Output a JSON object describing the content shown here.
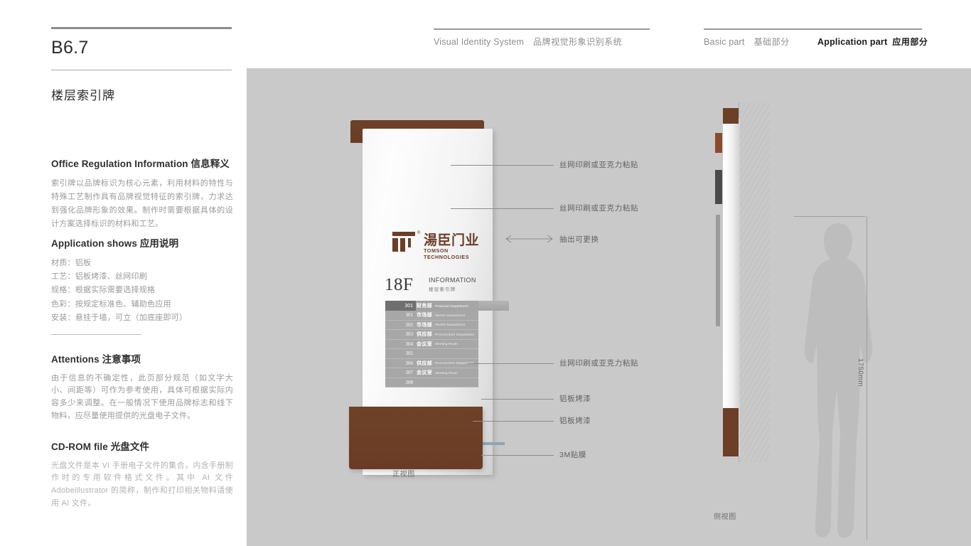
{
  "header": {
    "vis_en": "Visual Identity System",
    "vis_cn": "品牌视觉形象识别系统",
    "basic_en": "Basic part",
    "basic_cn": "基础部分",
    "app_en": "Application part",
    "app_cn": "应用部分"
  },
  "page": {
    "code": "B6.7",
    "section_title": "楼层索引牌"
  },
  "blocks": {
    "office": {
      "heading": "Office Regulation Information 信息释义",
      "body": "索引牌以品牌标识为核心元素，利用材料的特性与特殊工艺制作具有品牌视觉特征的索引牌，力求达到强化品牌形象的效果。制作时需要根据具体的设计方案选择标识的材料和工艺。"
    },
    "application": {
      "heading": "Application shows 应用说明",
      "lines": [
        "材质：铝板",
        "工艺：铝板烤漆、丝网印刷",
        "规格：根据实际需要选择规格",
        "色彩：按规定标准色、辅助色应用",
        "安装：悬挂于墙，可立（加底座即可）"
      ]
    },
    "attentions": {
      "heading": "Attentions 注意事项",
      "body": "由于信息的不确定性，此页部分规范（如文字大小、间距等）可作为参考使用，具体可根据实际内容多少来调整。在一般情况下使用品牌标志和线下物料，应尽量使用提供的光盘电子文件。"
    },
    "cdrom": {
      "heading": "CD-ROM file 光盘文件",
      "body": "光盘文件是本 VI 手册电子文件的集合，内含手册制作时的专用软件格式文件。其中 AI 文件 Adobeillustrator 的简称，制作和打印相关物料请使用 AI 文件。"
    }
  },
  "sign": {
    "logo_cn": "湯臣门业",
    "logo_reg": "®",
    "logo_en": "TOMSON TECHNOLOGIES",
    "floor_number": "18F",
    "floor_info_en": "INFORMATION",
    "floor_info_cn": "楼层索引牌",
    "directory_header": {
      "num": "301",
      "cn": "财务部",
      "en": "Financial Department"
    },
    "directory_rows": [
      {
        "num": "301",
        "cn": "市场部",
        "en": "Market Department"
      },
      {
        "num": "302",
        "cn": "市场部",
        "en": "Market Department"
      },
      {
        "num": "303",
        "cn": "供应部",
        "en": "Procurement Department"
      },
      {
        "num": "304",
        "cn": "会议室",
        "en": "Meeting Room"
      },
      {
        "num": "305",
        "cn": "",
        "en": ""
      },
      {
        "num": "306",
        "cn": "供应部",
        "en": "Procurement Department"
      },
      {
        "num": "307",
        "cn": "会议室",
        "en": "Meeting Room"
      },
      {
        "num": "308",
        "cn": "",
        "en": ""
      }
    ]
  },
  "annotations": {
    "a1": "丝网印刷或亚克力粘贴",
    "a2": "丝网印刷或亚克力粘贴",
    "a3": "抽出可更换",
    "a4": "丝网印刷或亚克力粘贴",
    "a5": "铝板烤漆",
    "a6": "铝板烤漆",
    "a7": "3M贴膜"
  },
  "captions": {
    "front_view": "正视图",
    "side_view": "侧视图",
    "dimension": "1750mm"
  },
  "colors": {
    "brand_brown": "#6b3f28",
    "accent_orange": "#c28157",
    "accent_blue": "#8fa4b4",
    "stage_grey": "#c9c9c9"
  }
}
